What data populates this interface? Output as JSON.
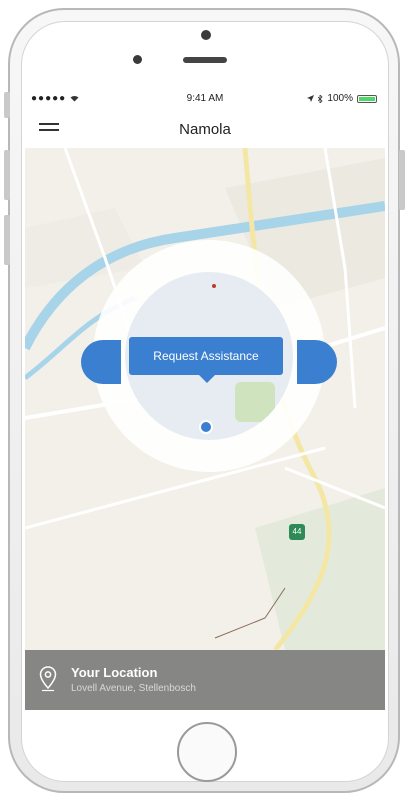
{
  "status_bar": {
    "signal": "●●●●●",
    "time": "9:41 AM",
    "battery_text": "100%"
  },
  "nav": {
    "title": "Namola"
  },
  "map": {
    "request_button_label": "Request Assistance",
    "route_shield_label": "44"
  },
  "location": {
    "title": "Your Location",
    "address": "Lovell Avenue, Stellenbosch"
  },
  "colors": {
    "accent": "#3a7fd0",
    "battery": "#4cd964",
    "route": "#2e8b57"
  },
  "icons": [
    "menu-icon",
    "wifi-icon",
    "bluetooth-icon",
    "battery-icon",
    "location-pin-icon",
    "route-shield-icon"
  ]
}
